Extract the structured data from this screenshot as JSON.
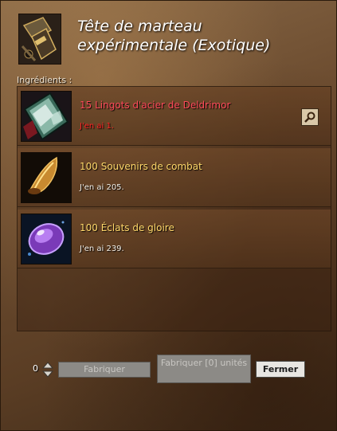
{
  "window": {
    "title": "Tête de marteau expérimentale (Exotique)",
    "ingredients_label": "Ingrédients :"
  },
  "ingredients": [
    {
      "name": "15 Lingots d'acier de Deldrimor",
      "owned": "J'en ai 1.",
      "icon": "ingot-icon",
      "insufficient": true
    },
    {
      "name": "100 Souvenirs de combat",
      "owned": "J'en ai 205.",
      "icon": "memento-icon",
      "insufficient": false
    },
    {
      "name": "100 Éclats de gloire",
      "owned": "J'en ai 239.",
      "icon": "glory-shard-icon",
      "insufficient": false
    }
  ],
  "footer": {
    "quantity": "0",
    "craft_label": "Fabriquer",
    "craft_units_label": "Fabriquer [0] unités",
    "close_label": "Fermer"
  },
  "colors": {
    "insufficient": "#ff4a5a",
    "item_name": "#ffd86a",
    "title": "#ffffff"
  }
}
